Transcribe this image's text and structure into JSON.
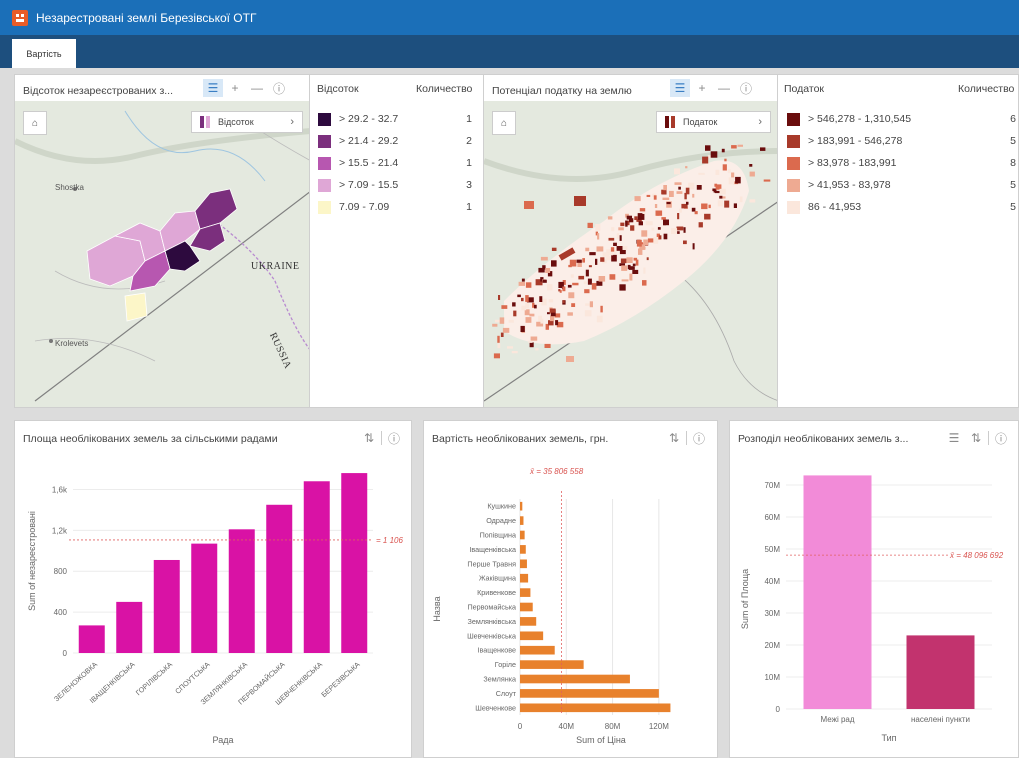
{
  "app": {
    "title": "Незарестровані землі Березівської ОТГ",
    "logo_icon": "app-logo-icon"
  },
  "tabs": [
    {
      "label": "Вартість"
    }
  ],
  "map1": {
    "title": "Відсоток незареєстрованих з...",
    "legend_button": "Відсоток",
    "labels": {
      "shostka": "Shostka",
      "ukraine": "UKRAINE",
      "russia": "RUSSIA",
      "krolevets": "Krolevets"
    }
  },
  "legend1": {
    "col1": "Відсоток",
    "col2": "Количество",
    "items": [
      {
        "label": "> 29.2 - 32.7",
        "count": "1",
        "color": "#2d0a3e"
      },
      {
        "label": "> 21.4 - 29.2",
        "count": "2",
        "color": "#7b2f7d"
      },
      {
        "label": "> 15.5 - 21.4",
        "count": "1",
        "color": "#b757b0"
      },
      {
        "label": "> 7.09 - 15.5",
        "count": "3",
        "color": "#dfa7d6"
      },
      {
        "label": "7.09 - 7.09",
        "count": "1",
        "color": "#fcf6c8"
      }
    ]
  },
  "map2": {
    "title": "Потенціал податку на землю",
    "legend_button": "Податок"
  },
  "legend2": {
    "col1": "Податок",
    "col2": "Количество",
    "items": [
      {
        "label": "> 546,278 - 1,310,545",
        "count": "6",
        "color": "#6a0d0d"
      },
      {
        "label": "> 183,991 - 546,278",
        "count": "5",
        "color": "#a83a2a"
      },
      {
        "label": "> 83,978 - 183,991",
        "count": "8",
        "color": "#db6a4e"
      },
      {
        "label": "> 41,953 - 83,978",
        "count": "5",
        "color": "#eeaa92"
      },
      {
        "label": "86 - 41,953",
        "count": "5",
        "color": "#fbe7dc"
      }
    ]
  },
  "chart_data": [
    {
      "type": "bar",
      "title": "Площа необлікованих земель за сільськими радами",
      "xlabel": "Рада",
      "ylabel": "Sum of незареєстровані",
      "categories": [
        "ЗЕЛЕНОЖОВКА",
        "ІВАЩЕНКІВСЬКА",
        "ГОРІЛІВСЬКА",
        "СПОУТСЬКА",
        "ЗЕМЛЯНКІВСЬКА",
        "ПЕРВОМАЙСЬКА",
        "ШЕВЧЕНКІВСЬКА",
        "БЕРЕЗІВСЬКА"
      ],
      "values": [
        270,
        500,
        910,
        1070,
        1210,
        1450,
        1680,
        1760
      ],
      "ylim": [
        0,
        1800
      ],
      "yticks": [
        "0",
        "400",
        "800",
        "1,2k",
        "1,6k"
      ],
      "yticks_values": [
        0,
        400,
        800,
        1200,
        1600
      ],
      "mean": 1106,
      "mean_label": "= 1 106",
      "color": "#d912a5"
    },
    {
      "type": "bar",
      "orientation": "horizontal",
      "title": "Вартість необлікованих земель, грн.",
      "xlabel": "Sum of Ціна",
      "ylabel": "Назва",
      "categories": [
        "Кушкине",
        "Одрадне",
        "Попівщина",
        "Іващенківська",
        "Перше Травня",
        "Жаківщина",
        "Кривенкове",
        "Первомайська",
        "Землянківська",
        "Шевченківська",
        "Іващенкове",
        "Горіле",
        "Землянка",
        "Слоут",
        "Шевченкове"
      ],
      "values": [
        2000000,
        3000000,
        4000000,
        5000000,
        6000000,
        7000000,
        9000000,
        11000000,
        14000000,
        20000000,
        30000000,
        55000000,
        95000000,
        120000000,
        130000000
      ],
      "xlim": [
        0,
        140000000
      ],
      "xticks": [
        "0",
        "40M",
        "80M",
        "120M"
      ],
      "xticks_values": [
        0,
        40000000,
        80000000,
        120000000
      ],
      "mean": 35806558,
      "mean_label": "x̄ = 35 806 558",
      "color": "#e8812c"
    },
    {
      "type": "bar",
      "title": "Розподіл необлікованих земель з...",
      "xlabel": "Тип",
      "ylabel": "Sum of Площа",
      "categories": [
        "Межі рад",
        "населені пункти"
      ],
      "values": [
        73000000,
        23000000
      ],
      "colors": [
        "#f28bd8",
        "#c2336e"
      ],
      "ylim": [
        0,
        75000000
      ],
      "yticks": [
        "0",
        "10M",
        "20M",
        "30M",
        "40M",
        "50M",
        "60M",
        "70M"
      ],
      "yticks_values": [
        0,
        10000000,
        20000000,
        30000000,
        40000000,
        50000000,
        60000000,
        70000000
      ],
      "mean": 48096692,
      "mean_label": "x̄ = 48 096 692"
    }
  ]
}
